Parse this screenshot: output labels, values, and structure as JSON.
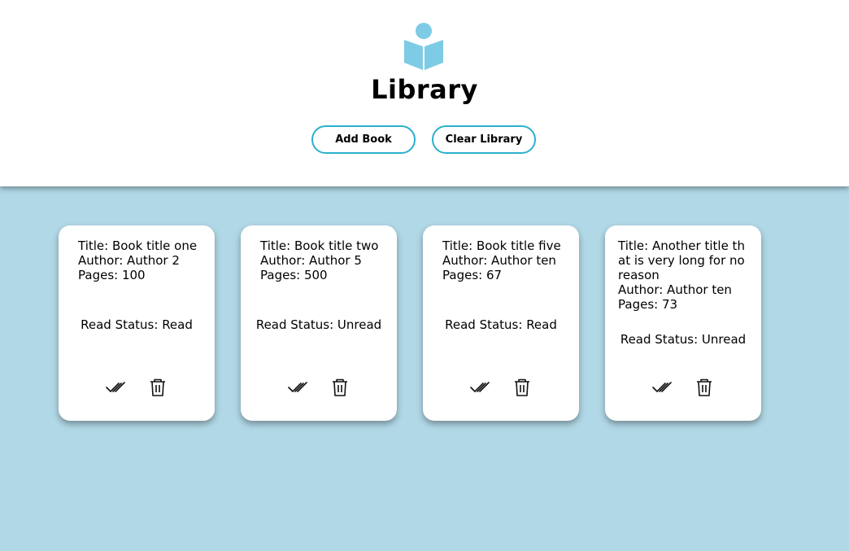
{
  "header": {
    "title": "Library",
    "logo_icon": "book-reader-icon",
    "logo_color": "#7ecbe5"
  },
  "buttons": {
    "add_label": "Add Book",
    "clear_label": "Clear Library",
    "border_color": "#2ab0cd"
  },
  "background_color": "#b1d8e6",
  "books": [
    {
      "title": "Title: Book title one",
      "author": "Author: Author 2",
      "pages": "Pages: 100",
      "status": "Read Status: Read"
    },
    {
      "title": "Title: Book title two",
      "author": "Author: Author 5",
      "pages": "Pages: 500",
      "status": "Read Status: Unread"
    },
    {
      "title": "Title: Book title five",
      "author": "Author: Author ten",
      "pages": "Pages: 67",
      "status": "Read Status: Read"
    },
    {
      "title": "Title: Another title that is very long for no reason",
      "author": "Author: Author ten",
      "pages": "Pages: 73",
      "status": "Read Status: Unread"
    }
  ],
  "card_icons": {
    "toggle": "double-check-icon",
    "delete": "trash-icon"
  }
}
